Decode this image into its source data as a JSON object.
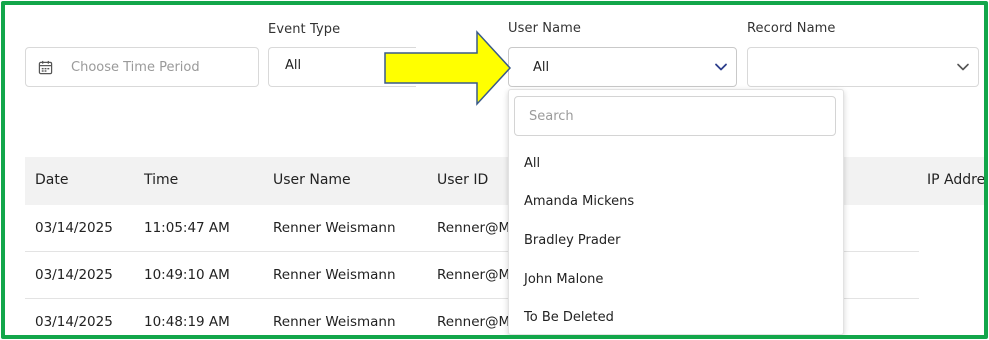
{
  "filters": {
    "time_period": {
      "placeholder": "Choose Time Period"
    },
    "event_type": {
      "label": "Event Type",
      "value": "All"
    },
    "user_name": {
      "label": "User Name",
      "value": "All"
    },
    "record_name": {
      "label": "Record Name",
      "value": ""
    }
  },
  "dropdown": {
    "search_placeholder": "Search",
    "options": [
      "All",
      "Amanda Mickens",
      "Bradley Prader",
      "John Malone",
      "To Be Deleted"
    ]
  },
  "table": {
    "headers": [
      "Date",
      "Time",
      "User Name",
      "User ID",
      "IP Addre"
    ],
    "rows": [
      [
        "03/14/2025",
        "11:05:47 AM",
        "Renner Weismann",
        "Renner@M"
      ],
      [
        "03/14/2025",
        "10:49:10 AM",
        "Renner Weismann",
        "Renner@M"
      ],
      [
        "03/14/2025",
        "10:48:19 AM",
        "Renner Weismann",
        "Renner@M"
      ]
    ]
  },
  "colors": {
    "frame_border": "#12a64a",
    "arrow_fill": "#ffff00",
    "arrow_stroke": "#3a5a8a",
    "chevron": "#2c3e8c"
  }
}
